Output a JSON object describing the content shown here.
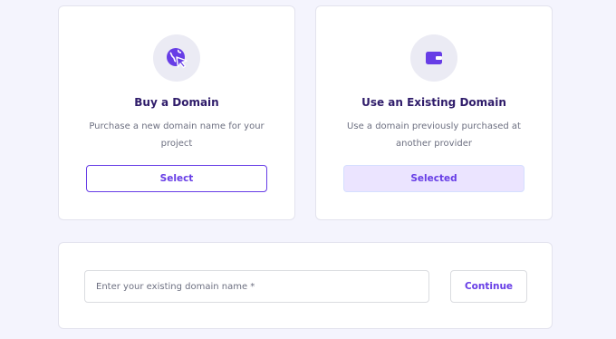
{
  "colors": {
    "accent": "#673de6",
    "background": "#f4f4fd",
    "title": "#2f1c6a",
    "muted_text": "#6d7081",
    "selected_bg": "#ebe4ff"
  },
  "options": [
    {
      "icon": "globe-cursor-icon",
      "title": "Buy a Domain",
      "description": "Purchase a new domain name for your project",
      "button_label": "Select",
      "selected": false
    },
    {
      "icon": "wallet-icon",
      "title": "Use an Existing Domain",
      "description": "Use a domain previously purchased at another provider",
      "button_label": "Selected",
      "selected": true
    }
  ],
  "domain_form": {
    "input_placeholder": "Enter your existing domain name *",
    "input_value": "",
    "continue_label": "Continue"
  }
}
